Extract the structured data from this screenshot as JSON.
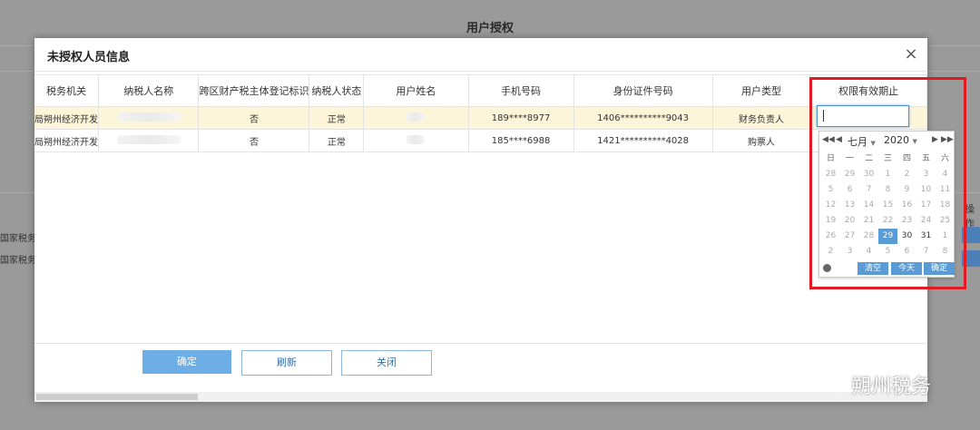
{
  "background": {
    "title": "用户授权",
    "left_items": [
      "国家税务总",
      "国家税务总"
    ],
    "right_label": "操作"
  },
  "modal": {
    "title": "未授权人员信息",
    "columns": [
      "税务机关",
      "纳税人名称",
      "跨区财产税主体登记标识",
      "纳税人状态",
      "用户姓名",
      "手机号码",
      "身份证件号码",
      "用户类型",
      "权限有效期止"
    ],
    "rows": [
      {
        "tax_office": "局朔州经济开发",
        "cross_region": "否",
        "status": "正常",
        "phone": "189****8977",
        "id_number": "1406**********9043",
        "user_type": "财务负责人"
      },
      {
        "tax_office": "局朔州经济开发",
        "cross_region": "否",
        "status": "正常",
        "phone": "185****6988",
        "id_number": "1421**********4028",
        "user_type": "购票人"
      }
    ],
    "buttons": {
      "confirm": "确定",
      "refresh": "刷新",
      "close": "关闭"
    }
  },
  "calendar": {
    "month": "七月",
    "year": "2020",
    "weekdays": [
      "日",
      "一",
      "二",
      "三",
      "四",
      "五",
      "六"
    ],
    "days": [
      [
        "28",
        "29",
        "30",
        "1",
        "2",
        "3",
        "4"
      ],
      [
        "5",
        "6",
        "7",
        "8",
        "9",
        "10",
        "11"
      ],
      [
        "12",
        "13",
        "14",
        "15",
        "16",
        "17",
        "18"
      ],
      [
        "19",
        "20",
        "21",
        "22",
        "23",
        "24",
        "25"
      ],
      [
        "26",
        "27",
        "28",
        "29",
        "30",
        "31",
        "1"
      ],
      [
        "2",
        "3",
        "4",
        "5",
        "6",
        "7",
        "8"
      ]
    ],
    "selected": "29",
    "clear": "清空",
    "today": "今天",
    "ok": "确定"
  },
  "watermark": "朔州税务",
  "colors": {
    "accent": "#5b9bd5",
    "highlight_row": "#fdf5d9",
    "annotation": "#e01b24"
  }
}
